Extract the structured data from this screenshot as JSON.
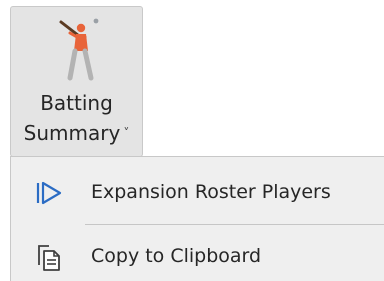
{
  "ribbon_button": {
    "label_line1": "Batting",
    "label_line2": "Summary",
    "chevron": "˅",
    "icon": "batter-icon",
    "state": "pressed"
  },
  "menu": {
    "items": [
      {
        "label": "Expansion Roster Players",
        "icon": "play-outline-icon",
        "icon_color": "#2b6cc4"
      },
      {
        "label": "Copy to Clipboard",
        "icon": "copy-document-icon",
        "icon_color": "#404040"
      }
    ]
  },
  "colors": {
    "button_pressed_bg": "#e4e4e4",
    "menu_bg": "#efefef",
    "batter_shirt": "#e8643a"
  }
}
